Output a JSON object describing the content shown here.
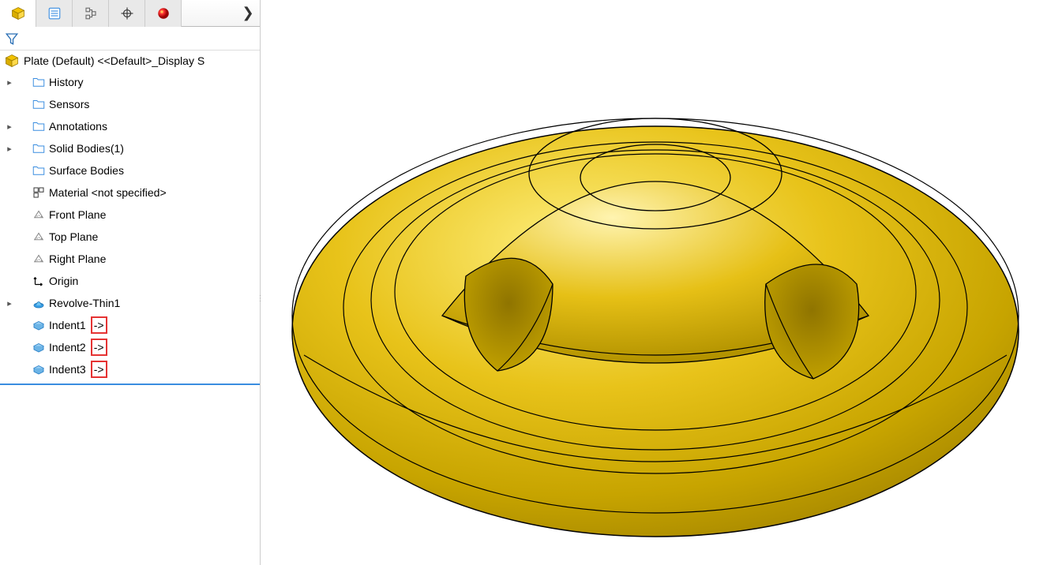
{
  "tabs": {
    "count": 5
  },
  "root": {
    "label": "Plate (Default) <<Default>_Display S"
  },
  "tree": [
    {
      "label": "History",
      "icon": "folder-clock",
      "expandable": true,
      "depth": 1
    },
    {
      "label": "Sensors",
      "icon": "folder-gauge",
      "expandable": false,
      "depth": 1
    },
    {
      "label": "Annotations",
      "icon": "folder-a",
      "expandable": true,
      "depth": 1
    },
    {
      "label": "Solid Bodies(1)",
      "icon": "folder-solid",
      "expandable": true,
      "depth": 1
    },
    {
      "label": "Surface Bodies",
      "icon": "folder-surface",
      "expandable": false,
      "depth": 1
    },
    {
      "label": "Material <not specified>",
      "icon": "material",
      "expandable": false,
      "depth": 1
    },
    {
      "label": "Front Plane",
      "icon": "plane",
      "expandable": false,
      "depth": 1
    },
    {
      "label": "Top Plane",
      "icon": "plane",
      "expandable": false,
      "depth": 1
    },
    {
      "label": "Right Plane",
      "icon": "plane",
      "expandable": false,
      "depth": 1
    },
    {
      "label": "Origin",
      "icon": "origin",
      "expandable": false,
      "depth": 1
    },
    {
      "label": "Revolve-Thin1",
      "icon": "revolve",
      "expandable": true,
      "depth": 1
    },
    {
      "label": "Indent1",
      "suffix": "->",
      "icon": "indent",
      "expandable": false,
      "depth": 1,
      "highlight": true
    },
    {
      "label": "Indent2",
      "suffix": "->",
      "icon": "indent",
      "expandable": false,
      "depth": 1,
      "highlight": true
    },
    {
      "label": "Indent3",
      "suffix": "->",
      "icon": "indent",
      "expandable": false,
      "depth": 1,
      "highlight": true
    }
  ]
}
